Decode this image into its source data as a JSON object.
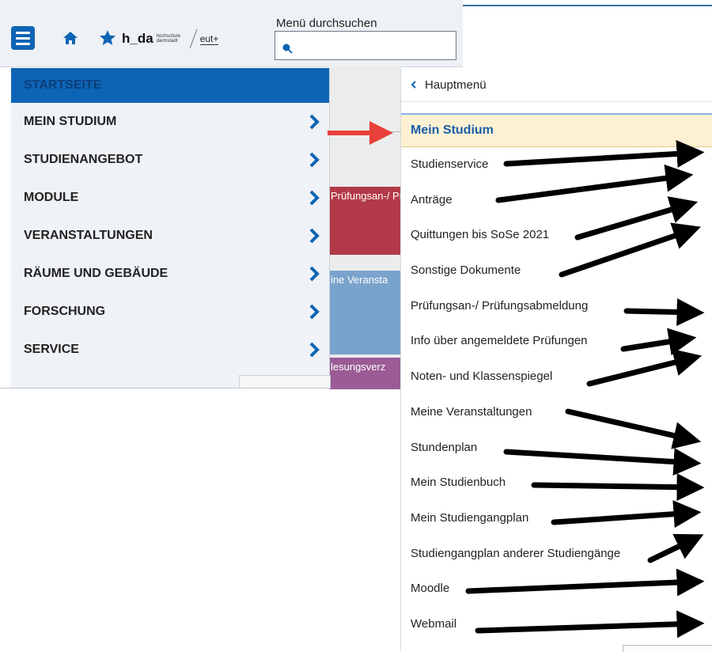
{
  "header": {
    "logo_main": "h_da",
    "logo_sub": "hochschule darmstadt",
    "logo_partner": "eut+",
    "search_label": "Menü durchsuchen",
    "search_value": ""
  },
  "background_tiles": {
    "red": "Prüfungsan-/ Pr",
    "blue": "ine Veransta",
    "purple": "lesungsverz"
  },
  "left_menu": {
    "home": "STARTSEITE",
    "items": [
      {
        "label": "MEIN STUDIUM"
      },
      {
        "label": "STUDIENANGEBOT"
      },
      {
        "label": "MODULE"
      },
      {
        "label": "VERANSTALTUNGEN"
      },
      {
        "label": "RÄUME UND GEBÄUDE"
      },
      {
        "label": "FORSCHUNG"
      },
      {
        "label": "SERVICE"
      }
    ]
  },
  "right_menu": {
    "back_label": "Hauptmenü",
    "active": "Mein Studium",
    "items": [
      {
        "label": "Studienservice"
      },
      {
        "label": "Anträge"
      },
      {
        "label": "Quittungen bis SoSe 2021"
      },
      {
        "label": "Sonstige Dokumente"
      },
      {
        "label": "Prüfungsan-/ Prüfungsabmeldung"
      },
      {
        "label": "Info über angemeldete Prüfungen"
      },
      {
        "label": "Noten- und Klassenspiegel"
      },
      {
        "label": "Meine Veranstaltungen"
      },
      {
        "label": "Stundenplan"
      },
      {
        "label": "Mein Studienbuch"
      },
      {
        "label": "Mein Studiengangplan"
      },
      {
        "label": "Studiengangplan anderer Studiengänge"
      },
      {
        "label": "Moodle"
      },
      {
        "label": "Webmail"
      }
    ]
  },
  "colors": {
    "brand_blue": "#0e64b4",
    "active_bg": "#fdf1d3",
    "annotation_red": "#e8403a",
    "annotation_black": "#000000"
  }
}
